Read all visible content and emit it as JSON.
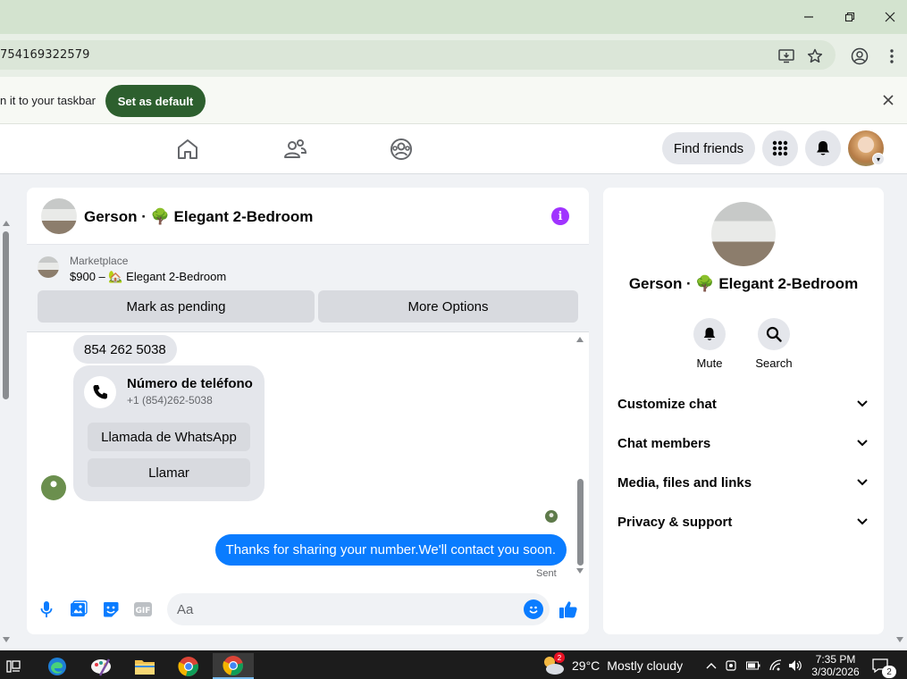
{
  "browser": {
    "url": "754169322579",
    "infobar_text": "n it to your taskbar",
    "set_default_label": "Set as default"
  },
  "header": {
    "find_friends_label": "Find friends"
  },
  "chat": {
    "title": "Gerson · 🌳 Elegant 2-Bedroom",
    "marketplace_label": "Marketplace",
    "listing": "$900 – 🏡 Elegant 2-Bedroom",
    "mark_pending_label": "Mark as pending",
    "more_options_label": "More Options",
    "messages": {
      "phone_text": "854 262 5038",
      "card_title": "Número de teléfono",
      "card_number": "+1 (854)262-5038",
      "whatsapp_label": "Llamada de WhatsApp",
      "call_label": "Llamar",
      "sent_text": "Thanks for sharing your number.We'll contact you soon.",
      "sent_status": "Sent"
    },
    "composer_placeholder": "Aa",
    "gif_label": "GIF"
  },
  "side_panel": {
    "name": "Gerson · 🌳 Elegant 2-Bedroom",
    "actions": [
      {
        "label": "Mute",
        "icon": "bell-icon"
      },
      {
        "label": "Search",
        "icon": "search-icon"
      }
    ],
    "sections": [
      {
        "label": "Customize chat"
      },
      {
        "label": "Chat members"
      },
      {
        "label": "Media, files and links"
      },
      {
        "label": "Privacy & support"
      }
    ]
  },
  "taskbar": {
    "weather_temp": "29°C",
    "weather_text": "Mostly cloudy",
    "weather_badge": "2",
    "time": "7:35 PM",
    "date": "3/30/2026",
    "notification_count": "2"
  },
  "colors": {
    "messenger_blue": "#0a7cff",
    "info_purple": "#a033ff",
    "default_button": "#2d5f2e"
  }
}
